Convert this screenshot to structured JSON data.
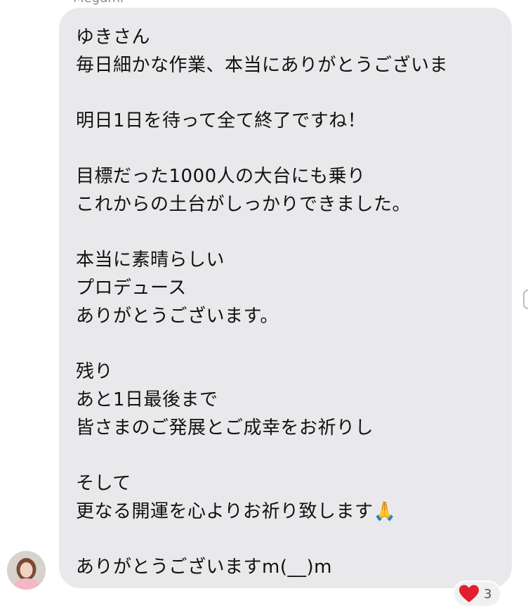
{
  "sender": {
    "name": "Megumi"
  },
  "message": {
    "lines": [
      "ゆきさん",
      "毎日細かな作業、本当にありがとうございま",
      "",
      "明日1日を待って全て終了ですね！",
      "",
      "目標だった1000人の大台にも乗り",
      "これからの土台がしっかりできました。",
      "",
      "本当に素晴らしい",
      "プロデュース",
      "ありがとうございます。",
      "",
      "残り",
      "あと1日最後まで",
      "皆さまのご発展とご成幸をお祈りし",
      "",
      "そして",
      "更なる開運を心よりお祈り致します🙏",
      "",
      "ありがとうございますm(__)m"
    ]
  },
  "reaction": {
    "icon": "heart-icon",
    "color": "#e0202e",
    "count": "3"
  },
  "colors": {
    "bubble": "#e9e9eb",
    "background": "#ffffff"
  }
}
